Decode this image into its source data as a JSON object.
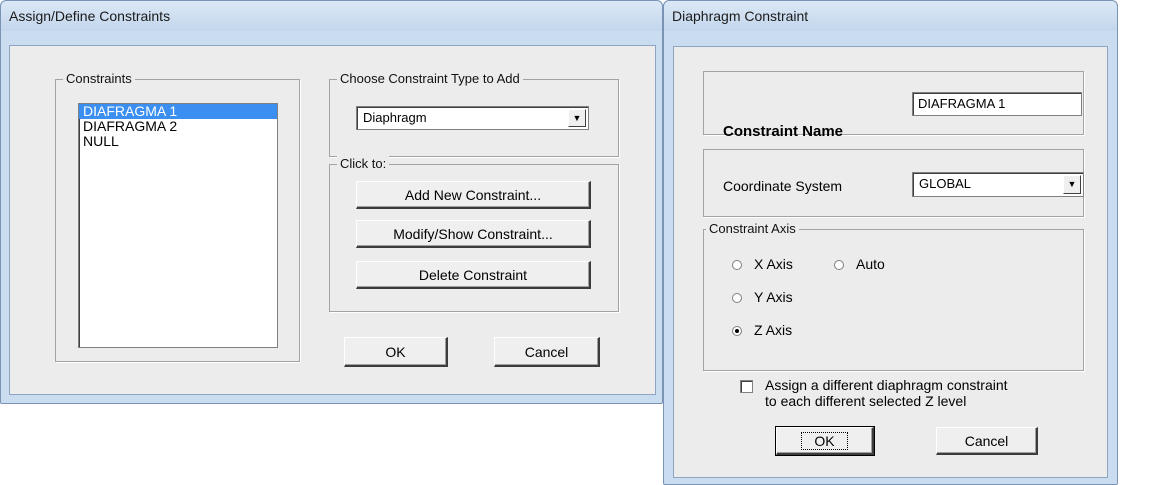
{
  "left_dialog": {
    "title": "Assign/Define Constraints",
    "constraints_group": "Constraints",
    "constraints_list": [
      "DIAFRAGMA 1",
      "DIAFRAGMA 2",
      "NULL"
    ],
    "type_group": "Choose Constraint Type to Add",
    "type_selected": "Diaphragm",
    "click_group": "Click to:",
    "add_button": "Add New Constraint...",
    "modify_button": "Modify/Show Constraint...",
    "delete_button": "Delete Constraint",
    "ok_button": "OK",
    "cancel_button": "Cancel"
  },
  "right_dialog": {
    "title": "Diaphragm Constraint",
    "name_label": "Constraint Name",
    "name_value": "DIAFRAGMA 1",
    "coord_label": "Coordinate System",
    "coord_value": "GLOBAL",
    "axis_group": "Constraint Axis",
    "axis_x": "X Axis",
    "axis_y": "Y Axis",
    "axis_z": "Z Axis",
    "axis_auto": "Auto",
    "selected_axis": "Z Axis",
    "assign_line1": "Assign a different diaphragm constraint",
    "assign_line2": "to each different selected Z level",
    "assign_checked": false,
    "ok_button": "OK",
    "cancel_button": "Cancel"
  },
  "icons": {
    "dropdown": "chevron-down-icon"
  }
}
